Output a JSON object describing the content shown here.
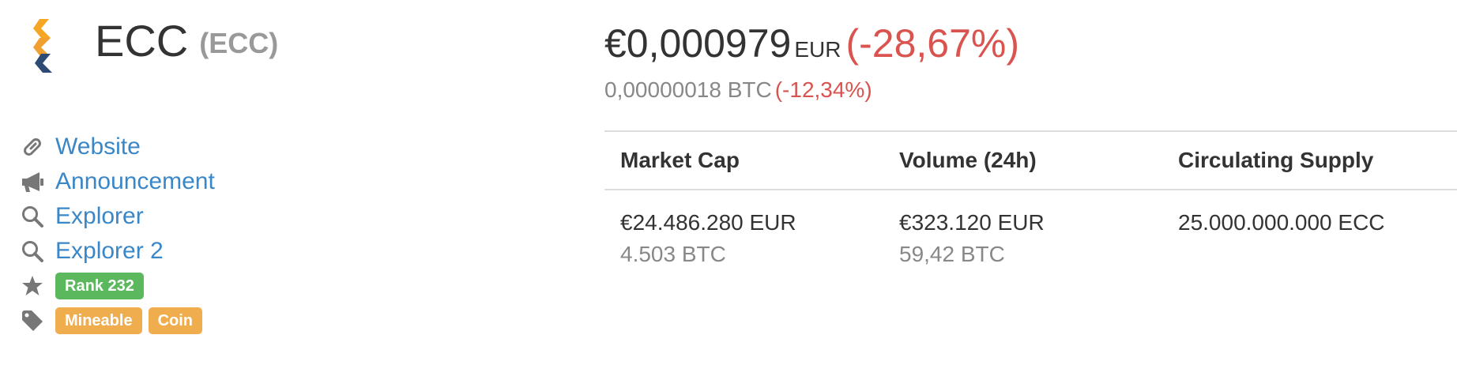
{
  "coin": {
    "name": "ECC",
    "symbol": "(ECC)",
    "logo_icon": "ecc-logo-icon",
    "logo_colors": [
      "#f5a623",
      "#2c4a73"
    ]
  },
  "links": [
    {
      "icon": "link-icon",
      "label": "Website"
    },
    {
      "icon": "megaphone-icon",
      "label": "Announcement"
    },
    {
      "icon": "search-icon",
      "label": "Explorer"
    },
    {
      "icon": "search-icon",
      "label": "Explorer 2"
    }
  ],
  "rank": {
    "icon": "star-icon",
    "label": "Rank 232",
    "color": "#5cb85c"
  },
  "tags": {
    "icon": "tag-icon",
    "items": [
      "Mineable",
      "Coin"
    ],
    "color": "#f0ad4e"
  },
  "price": {
    "main": "€0,000979",
    "currency": "EUR",
    "change": "(-28,67%)",
    "btc": "0,00000018 BTC",
    "btc_change": "(-12,34%)",
    "negative_color": "#d9534f"
  },
  "stats": {
    "headers": [
      "Market Cap",
      "Volume (24h)",
      "Circulating Supply"
    ],
    "market_cap": {
      "main": "€24.486.280 EUR",
      "btc": "4.503 BTC"
    },
    "volume": {
      "main": "€323.120 EUR",
      "btc": "59,42 BTC"
    },
    "supply": {
      "main": "25.000.000.000 ECC"
    }
  },
  "link_color": "#3a87c8"
}
